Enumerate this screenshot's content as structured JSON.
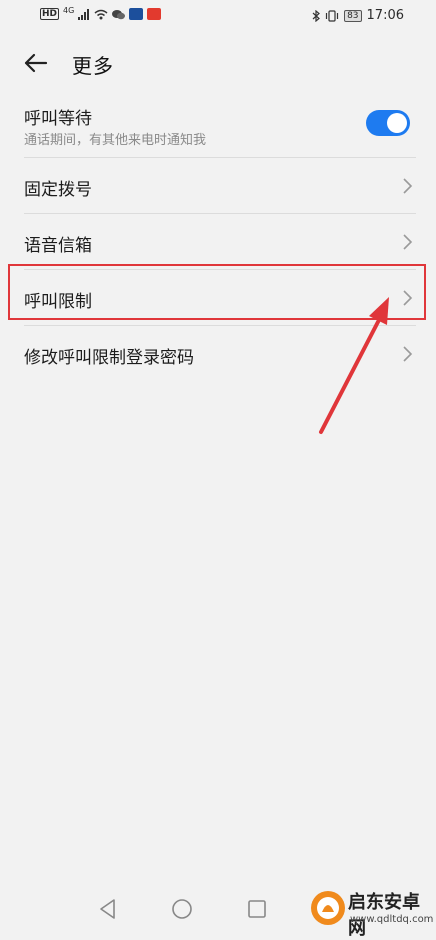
{
  "status_bar": {
    "hd": "HD",
    "network": "4G",
    "battery": "83",
    "time": "17:06"
  },
  "header": {
    "title": "更多",
    "back_icon": "arrow-left-icon"
  },
  "settings": [
    {
      "label": "呼叫等待",
      "subtitle": "通话期间，有其他来电时通知我",
      "type": "toggle",
      "enabled": true
    },
    {
      "label": "固定拨号",
      "type": "link"
    },
    {
      "label": "语音信箱",
      "type": "link"
    },
    {
      "label": "呼叫限制",
      "type": "link",
      "highlighted": true
    },
    {
      "label": "修改呼叫限制登录密码",
      "type": "link"
    }
  ],
  "colors": {
    "accent": "#1e7bf0",
    "highlight": "#e0363a",
    "background": "#f2f2f2"
  },
  "watermark": {
    "name": "启东安卓网",
    "url": "www.qdltdq.com"
  }
}
